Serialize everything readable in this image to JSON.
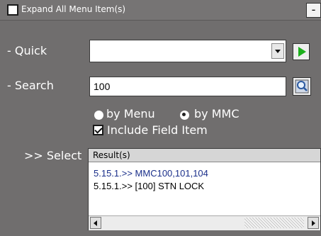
{
  "header": {
    "expand_all_label": "Expand All Menu Item(s)",
    "expand_all_checked": false,
    "collapse_label": "-"
  },
  "quick": {
    "label": "- Quick",
    "value": "",
    "dropdown_icon": "chevron-down-icon",
    "go_icon": "play-icon",
    "go_color": "#1cb01c"
  },
  "search": {
    "label": "- Search",
    "value": "100",
    "button_icon": "magnifier-icon"
  },
  "options": {
    "by_menu_label": "by Menu",
    "by_menu_selected": false,
    "by_mmc_label": "by MMC",
    "by_mmc_selected": true,
    "include_field_label": "Include Field Item",
    "include_field_checked": true
  },
  "select": {
    "label": ">> Select",
    "results_header": "Result(s)",
    "results": [
      {
        "text": "5.15.1.>> MMC100,101,104",
        "color": "#1a2f8a"
      },
      {
        "text": "5.15.1.>> [100] STN LOCK",
        "color": "#000000"
      }
    ]
  }
}
